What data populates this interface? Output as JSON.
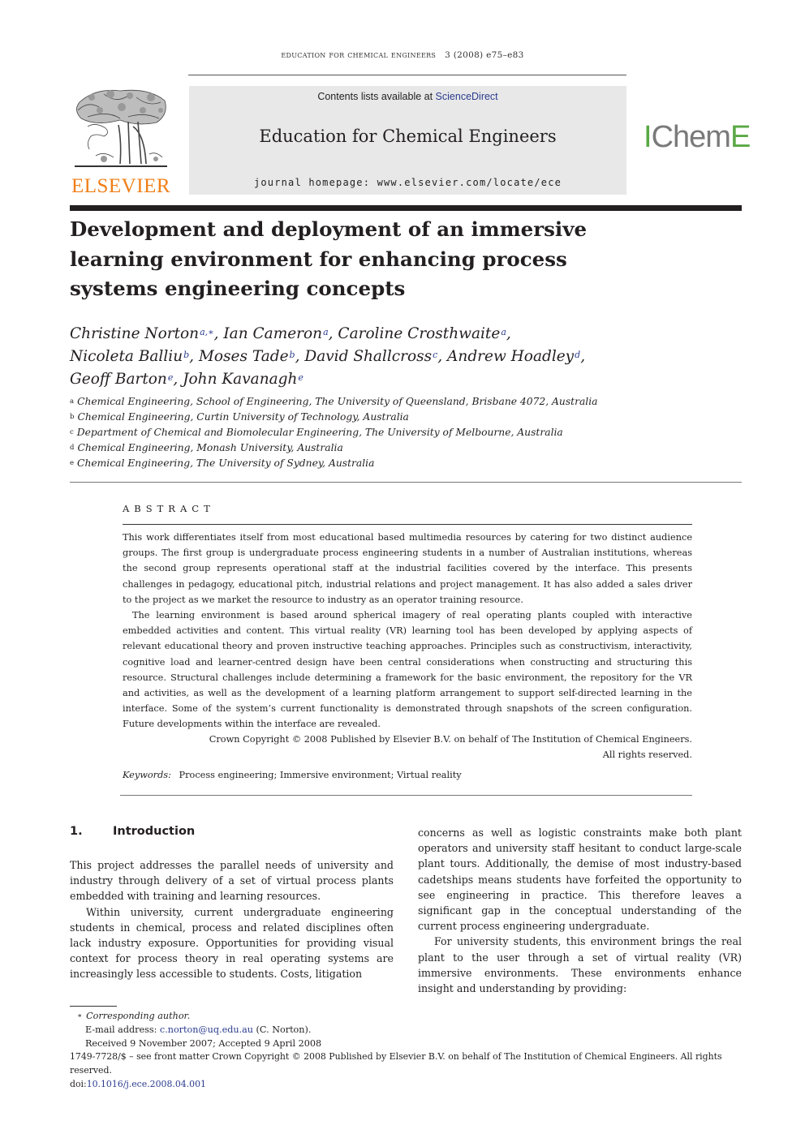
{
  "running_head": {
    "journal": "education for chemical engineers",
    "citation": "3 (2008) e75–e83"
  },
  "banner": {
    "contents_prefix": "Contents lists available at ",
    "contents_link": "ScienceDirect",
    "journal_title": "Education for Chemical Engineers",
    "homepage": "journal homepage: www.elsevier.com/locate/ece"
  },
  "logos": {
    "publisher": "ELSEVIER",
    "society_prefix": "I",
    "society_middle": "Chem",
    "society_suffix": "E"
  },
  "colors": {
    "elsevier_orange": "#f07f17",
    "icheme_green": "#5aa845",
    "link_blue": "#2a3b8f"
  },
  "article": {
    "title_lines": [
      "Development and deployment of an immersive",
      "learning environment for enhancing process",
      "systems engineering concepts"
    ],
    "authors": [
      {
        "name": "Christine Norton",
        "aff": "a,∗",
        "sep": ", "
      },
      {
        "name": "Ian Cameron",
        "aff": "a",
        "sep": ", "
      },
      {
        "name": "Caroline Crosthwaite",
        "aff": "a",
        "sep": ","
      },
      {
        "name": "Nicoleta Balliu",
        "aff": "b",
        "sep": ", "
      },
      {
        "name": "Moses Tade",
        "aff": "b",
        "sep": ", "
      },
      {
        "name": "David Shallcross",
        "aff": "c",
        "sep": ", "
      },
      {
        "name": "Andrew Hoadley",
        "aff": "d",
        "sep": ","
      },
      {
        "name": "Geoff Barton",
        "aff": "e",
        "sep": ", "
      },
      {
        "name": "John Kavanagh",
        "aff": "e",
        "sep": ""
      }
    ],
    "affiliations": [
      {
        "key": "a",
        "text": "Chemical Engineering, School of Engineering, The University of Queensland, Brisbane 4072, Australia"
      },
      {
        "key": "b",
        "text": "Chemical Engineering, Curtin University of Technology, Australia"
      },
      {
        "key": "c",
        "text": "Department of Chemical and Biomolecular Engineering, The University of Melbourne, Australia"
      },
      {
        "key": "d",
        "text": "Chemical Engineering, Monash University, Australia"
      },
      {
        "key": "e",
        "text": "Chemical Engineering, The University of Sydney, Australia"
      }
    ]
  },
  "abstract": {
    "heading": "ABSTRACT",
    "paragraphs": [
      "This work differentiates itself from most educational based multimedia resources by catering for two distinct audience groups. The first group is undergraduate process engineering students in a number of Australian institutions, whereas the second group represents operational staff at the industrial facilities covered by the interface. This presents challenges in pedagogy, educational pitch, industrial relations and project management. It has also added a sales driver to the project as we market the resource to industry as an operator training resource.",
      "The learning environment is based around spherical imagery of real operating plants coupled with interactive embedded activities and content. This virtual reality (VR) learning tool has been developed by applying aspects of relevant educational theory and proven instructive teaching approaches. Principles such as constructivism, interactivity, cognitive load and learner-centred design have been central considerations when constructing and structuring this resource. Structural challenges include determining a framework for the basic environment, the repository for the VR and activities, as well as the development of a learning platform arrangement to support self-directed learning in the interface. Some of the system’s current functionality is demonstrated through snapshots of the screen configuration. Future developments within the interface are revealed."
    ],
    "copyright_line1": "Crown Copyright © 2008 Published by Elsevier B.V. on behalf of The Institution of Chemical Engineers.",
    "copyright_line2": "All rights reserved.",
    "keywords_label": "Keywords:",
    "keywords": "Process engineering; Immersive environment; Virtual reality"
  },
  "section1": {
    "number": "1.",
    "heading": "Introduction",
    "left_paragraphs": [
      "This project addresses the parallel needs of university and industry through delivery of a set of virtual process plants embedded with training and learning resources.",
      "Within university, current undergraduate engineering students in chemical, process and related disciplines often lack industry exposure. Opportunities for providing visual context for process theory in real operating systems are increasingly less accessible to students. Costs, litigation"
    ],
    "right_paragraphs": [
      "concerns as well as logistic constraints make both plant operators and university staff hesitant to conduct large-scale plant tours. Additionally, the demise of most industry-based cadetships means students have forfeited the opportunity to see engineering in practice. This therefore leaves a significant gap in the conceptual understanding of the current process engineering undergraduate.",
      "For university students, this environment brings the real plant to the user through a set of virtual reality (VR) immersive environments. These environments enhance insight and understanding by providing:"
    ]
  },
  "footnotes": {
    "star": "∗",
    "corresponding": "Corresponding author.",
    "email_label": "E-mail address: ",
    "email": "c.norton@uq.edu.au",
    "email_suffix": " (C. Norton).",
    "received": "Received 9 November 2007; Accepted 9 April 2008",
    "front_matter": "1749-7728/$ – see front matter Crown Copyright © 2008 Published by Elsevier B.V. on behalf of The Institution of Chemical Engineers. All rights reserved.",
    "doi_label": "doi:",
    "doi": "10.1016/j.ece.2008.04.001"
  }
}
